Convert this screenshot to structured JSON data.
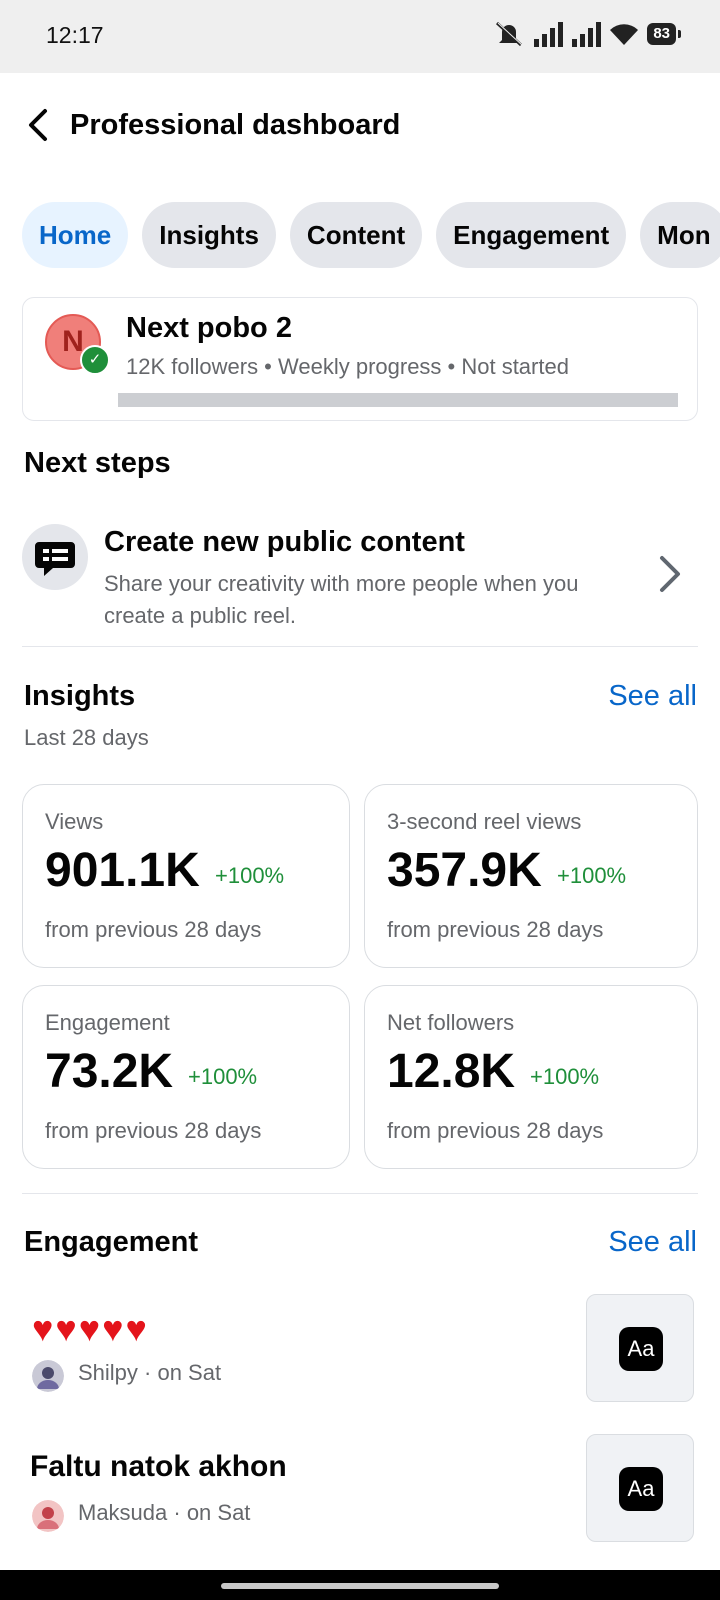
{
  "status_bar": {
    "time": "12:17",
    "battery": "83",
    "icons": [
      "mute-icon",
      "signal-icon",
      "signal-icon",
      "wifi-icon",
      "battery-icon"
    ]
  },
  "header": {
    "title": "Professional dashboard"
  },
  "tabs": [
    {
      "label": "Home",
      "active": true
    },
    {
      "label": "Insights"
    },
    {
      "label": "Content"
    },
    {
      "label": "Engagement"
    },
    {
      "label": "Mon"
    }
  ],
  "profile": {
    "initial": "N",
    "name": "Next pobo 2",
    "subtitle": "12K followers • Weekly progress • Not started",
    "progress": 0
  },
  "next_steps": {
    "title": "Next steps",
    "item": {
      "title": "Create new public content",
      "description": "Share your creativity with more people when you create a public reel."
    }
  },
  "insights": {
    "title": "Insights",
    "see_all": "See all",
    "period": "Last 28 days",
    "metrics": [
      {
        "label": "Views",
        "value": "901.1K",
        "change": "+100%",
        "footer": "from previous 28 days"
      },
      {
        "label": "3-second reel views",
        "value": "357.9K",
        "change": "+100%",
        "footer": "from previous 28 days"
      },
      {
        "label": "Engagement",
        "value": "73.2K",
        "change": "+100%",
        "footer": "from previous 28 days"
      },
      {
        "label": "Net followers",
        "value": "12.8K",
        "change": "+100%",
        "footer": "from previous 28 days"
      }
    ]
  },
  "engagement": {
    "title": "Engagement",
    "see_all": "See all",
    "items": [
      {
        "title": "♥♥♥♥♥",
        "meta": "Shilpy · on Sat",
        "thumb": "Aa"
      },
      {
        "title": "Faltu natok akhon",
        "meta": "Maksuda · on Sat",
        "thumb": "Aa"
      }
    ]
  },
  "colors": {
    "accent": "#0866c9",
    "positive": "#1f8f3a",
    "heart": "#e4141b"
  }
}
